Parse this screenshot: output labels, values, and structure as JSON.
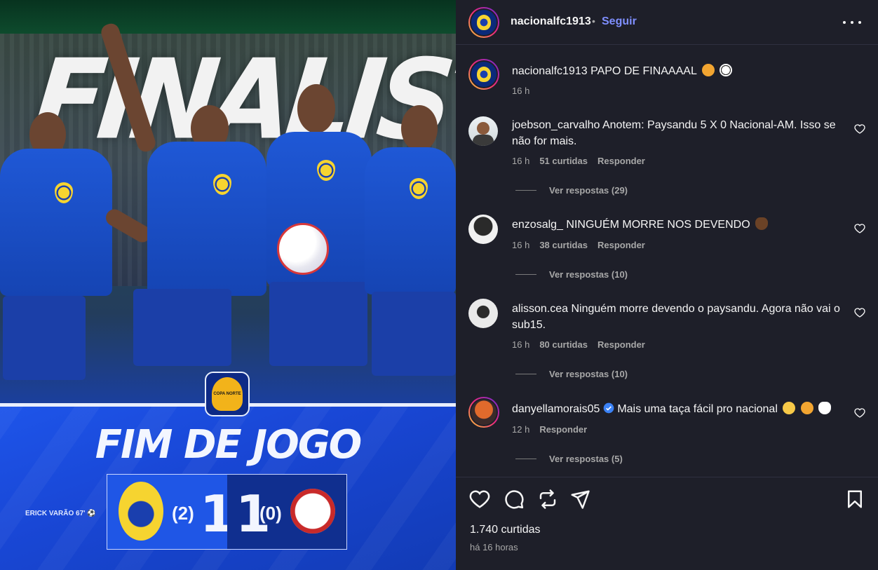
{
  "media": {
    "headline": "FINALISTA",
    "result_title": "FIM DE JOGO",
    "scorer": "ERICK VARÃO 67'",
    "home_penalties": "(2)",
    "home_score": "1",
    "away_score": "1",
    "away_penalties": "(0)",
    "cup_logo_text": "COPA NORTE"
  },
  "post": {
    "username": "nacionalfc1913",
    "separator": "•",
    "follow_label": "Seguir",
    "caption_user": "nacionalfc1913",
    "caption_text": "PAPO DE FINAAAAL",
    "caption_time": "16 h",
    "likes": "1.740 curtidas",
    "posted": "há 16 horas"
  },
  "comments": [
    {
      "user": "joebson_carvalho",
      "text": "Anotem: Paysandu 5 X 0 Nacional-AM. Isso se não for mais.",
      "time": "16 h",
      "likes": "51 curtidas",
      "reply_label": "Responder",
      "replies": "Ver respostas (29)"
    },
    {
      "user": "enzosalg_",
      "text": "NINGUÉM MORRE NOS DEVENDO",
      "time": "16 h",
      "likes": "38 curtidas",
      "reply_label": "Responder",
      "replies": "Ver respostas (10)"
    },
    {
      "user": "alisson.cea",
      "text": "Ninguém morre devendo o paysandu. Agora não vai o sub15.",
      "time": "16 h",
      "likes": "80 curtidas",
      "reply_label": "Responder",
      "replies": "Ver respostas (10)"
    },
    {
      "user": "danyellamorais05",
      "text": "Mais uma taça fácil pro nacional",
      "time": "12 h",
      "likes": "",
      "reply_label": "Responder",
      "replies": "Ver respostas (5)"
    }
  ],
  "icons": {
    "like": "heart-icon",
    "comment": "comment-icon",
    "repost": "repost-icon",
    "share": "send-icon",
    "save": "bookmark-icon",
    "more": "more-icon",
    "verified": "verified-badge-icon"
  },
  "colors": {
    "panel_bg": "#1e1f29",
    "follow": "#7f8fff",
    "muted": "#a8a8a8",
    "verified": "#3b82f6",
    "team_blue": "#1f56e6"
  }
}
